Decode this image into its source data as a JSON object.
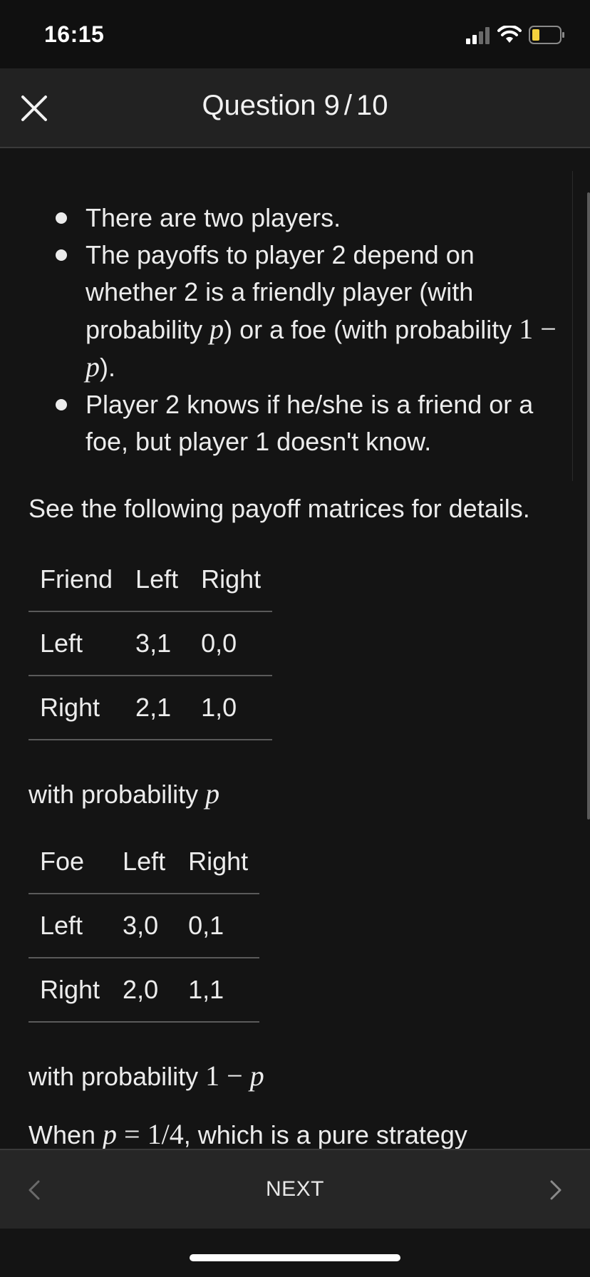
{
  "status": {
    "time": "16:15"
  },
  "header": {
    "title_prefix": "Question",
    "current": "9",
    "total": "10",
    "separator": "/"
  },
  "bullets": [
    {
      "text": "There are two players."
    },
    {
      "pre": "The payoffs to player 2 depend on whether 2 is a friendly player (with probability ",
      "var1": "p",
      "mid": ") or a foe (with probability ",
      "expr": "1 − ",
      "var2": "p",
      "post": ")."
    },
    {
      "text": "Player 2 knows if he/she is a friend or a foe, but player 1 doesn't know."
    }
  ],
  "intro": "See the following payoff matrices for details.",
  "friend_table": {
    "header": [
      "Friend",
      "Left",
      "Right"
    ],
    "rows": [
      [
        "Left",
        "3,1",
        "0,0"
      ],
      [
        "Right",
        "2,1",
        "1,0"
      ]
    ]
  },
  "friend_caption": {
    "text": "with probability ",
    "var": "p"
  },
  "foe_table": {
    "header": [
      "Foe",
      "Left",
      "Right"
    ],
    "rows": [
      [
        "Left",
        "3,0",
        "0,1"
      ],
      [
        "Right",
        "2,0",
        "1,1"
      ]
    ]
  },
  "foe_caption": {
    "text": "with probability ",
    "expr": "1 − ",
    "var": "p"
  },
  "question": {
    "pre": "When ",
    "var": "p",
    "eq": " = 1/4",
    "post": ", which is a pure strategy"
  },
  "footer": {
    "next_label": "NEXT"
  },
  "icons": {
    "close": "close-icon",
    "prev": "chevron-left-icon",
    "next": "chevron-right-icon",
    "signal": "cellular-signal-icon",
    "wifi": "wifi-icon",
    "battery": "battery-icon"
  },
  "colors": {
    "background": "#141414",
    "header": "#222222",
    "battery_level": "#f4d13d"
  }
}
